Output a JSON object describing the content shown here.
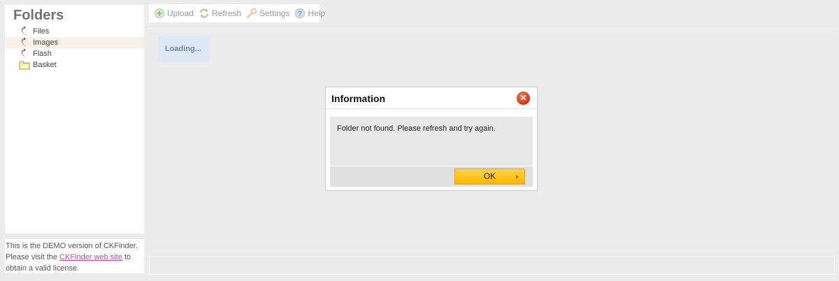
{
  "sidebar": {
    "title": "Folders",
    "folders": [
      {
        "label": "Files",
        "icon": "loading-spinner-icon",
        "selected": false
      },
      {
        "label": "Images",
        "icon": "loading-spinner-icon",
        "selected": true
      },
      {
        "label": "Flash",
        "icon": "loading-spinner-icon",
        "selected": false
      },
      {
        "label": "Basket",
        "icon": "folder-icon",
        "selected": false
      }
    ],
    "demo_note": {
      "text_before": "This is the DEMO version of CKFinder. Please visit the ",
      "link_text": "CKFinder web site",
      "text_after": " to obtain a valid license."
    }
  },
  "toolbar": {
    "upload_label": "Upload",
    "refresh_label": "Refresh",
    "settings_label": "Settings",
    "help_label": "Help"
  },
  "main": {
    "loading_text": "Loading..."
  },
  "dialog": {
    "title": "Information",
    "message": "Folder not found. Please refresh and try again.",
    "ok_label": "OK"
  },
  "colors": {
    "accent_button": "#fbb700",
    "close_button": "#e23a12",
    "selected_row": "#f7f0e6",
    "loading_box": "#dde9f7",
    "link": "#b0509e"
  }
}
